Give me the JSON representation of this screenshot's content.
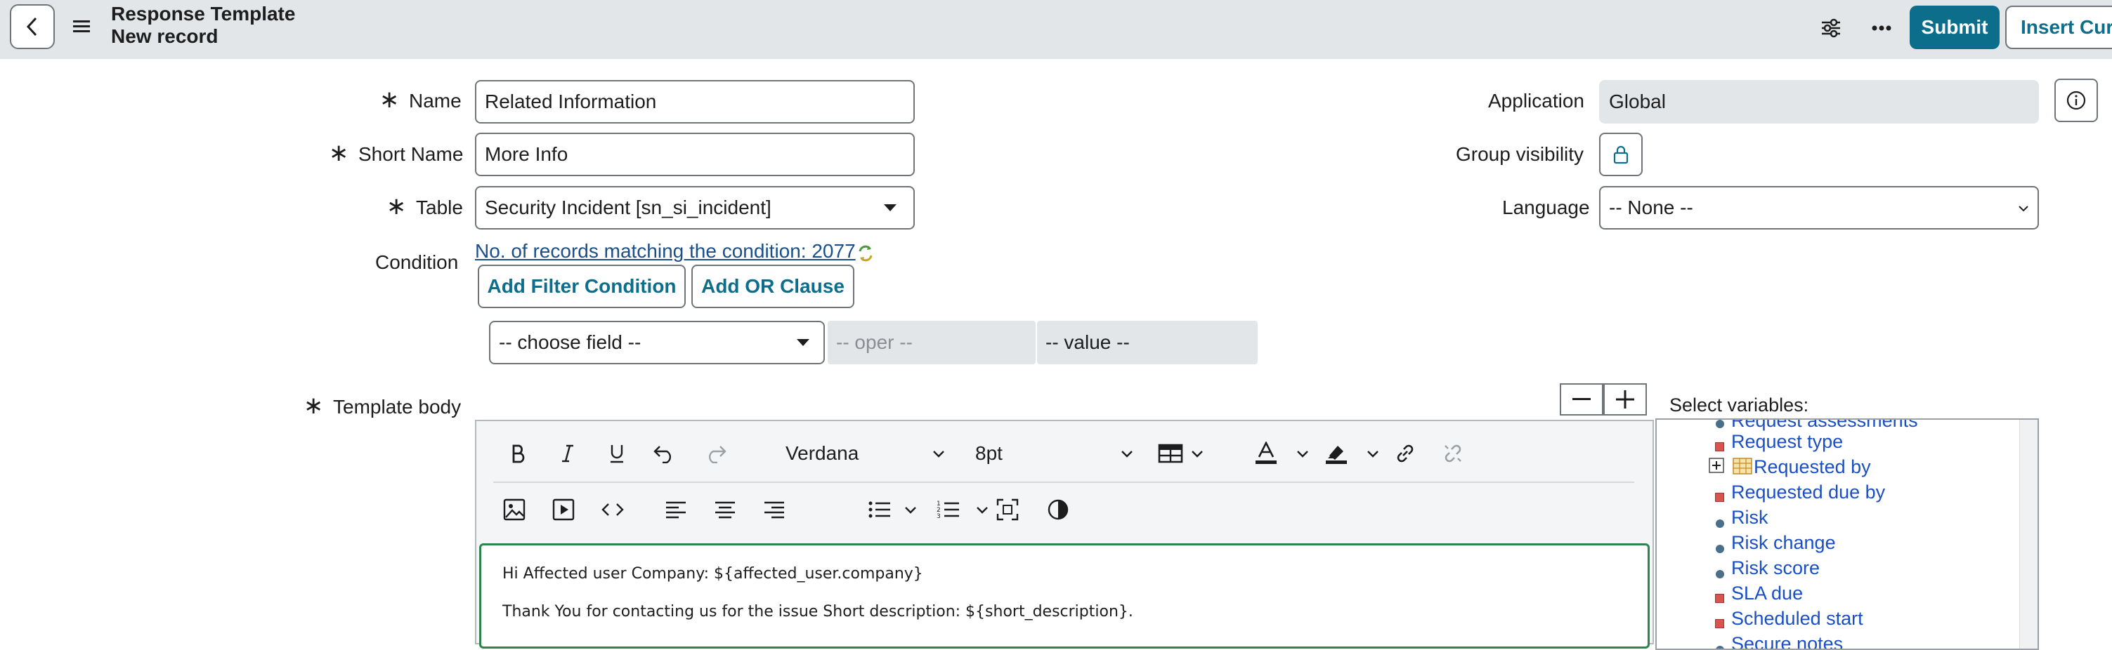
{
  "header": {
    "title_line1": "Response Template",
    "title_line2": "New record",
    "submit_label": "Submit",
    "insert_label": "Insert Curr"
  },
  "form": {
    "name_label": "Name",
    "name_value": "Related Information",
    "short_name_label": "Short Name",
    "short_name_value": "More Info",
    "table_label": "Table",
    "table_value": "Security Incident [sn_si_incident]",
    "condition_label": "Condition",
    "condition_link": "No. of records matching the condition: 2077",
    "add_filter_label": "Add Filter Condition",
    "add_or_label": "Add OR Clause",
    "choose_field": "-- choose field --",
    "oper": "-- oper --",
    "value": "-- value --",
    "application_label": "Application",
    "application_value": "Global",
    "group_visibility_label": "Group visibility",
    "language_label": "Language",
    "language_value": "-- None --",
    "template_body_label": "Template body"
  },
  "editor": {
    "font_family": "Verdana",
    "font_size": "8pt",
    "body_lines": [
      "Hi Affected user Company: ${affected_user.company}",
      "Thank You for contacting us for the issue Short description: ${short_description}."
    ]
  },
  "variables": {
    "title": "Select variables:",
    "items": [
      {
        "label": "Request assessments",
        "bullet": "dot"
      },
      {
        "label": "Request type",
        "bullet": "square"
      },
      {
        "label": "Requested by",
        "bullet": "table"
      },
      {
        "label": "Requested due by",
        "bullet": "square"
      },
      {
        "label": "Risk",
        "bullet": "dot"
      },
      {
        "label": "Risk change",
        "bullet": "dot"
      },
      {
        "label": "Risk score",
        "bullet": "dot"
      },
      {
        "label": "SLA due",
        "bullet": "square"
      },
      {
        "label": "Scheduled start",
        "bullet": "square"
      },
      {
        "label": "Secure notes",
        "bullet": "dot"
      }
    ]
  },
  "colors": {
    "accent": "#0d6e8c",
    "header_bg": "#e3e6e8",
    "link": "#1a4fc4",
    "editor_focus": "#2e844a"
  }
}
